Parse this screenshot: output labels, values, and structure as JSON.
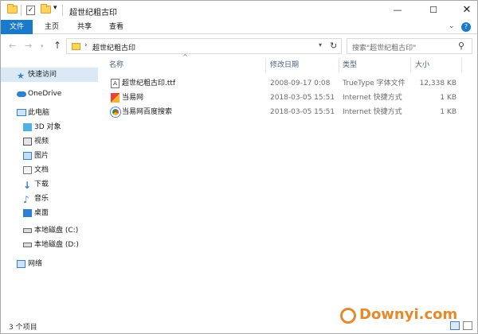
{
  "window": {
    "title": "超世纪粗古印",
    "controls": {
      "minimize": "—",
      "maximize": "☐",
      "close": "✕"
    }
  },
  "quick_access_toolbar": {
    "dropdown": "▾"
  },
  "ribbon": {
    "tabs": [
      "文件",
      "主页",
      "共享",
      "查看"
    ],
    "active_tab": "文件",
    "accent_color": "#1979ca",
    "expand_glyph": "⌄",
    "help_glyph": "?"
  },
  "navigation": {
    "back": "←",
    "forward": "→",
    "recent": "▾",
    "up": "↑",
    "path_separator": "›",
    "path": "超世纪粗古印",
    "dropdown": "▾",
    "refresh": "↻"
  },
  "search": {
    "placeholder": "搜索\"超世纪粗古印\"",
    "icon": "⚲"
  },
  "sidebar": {
    "items": [
      {
        "label": "快速访问",
        "icon": "star-icon"
      },
      {
        "label": "OneDrive",
        "icon": "cloud-icon"
      },
      {
        "label": "此电脑",
        "icon": "computer-icon"
      },
      {
        "label": "3D 对象",
        "icon": "cube-icon"
      },
      {
        "label": "视频",
        "icon": "video-icon"
      },
      {
        "label": "图片",
        "icon": "picture-icon"
      },
      {
        "label": "文档",
        "icon": "document-icon"
      },
      {
        "label": "下载",
        "icon": "download-icon"
      },
      {
        "label": "音乐",
        "icon": "music-icon"
      },
      {
        "label": "桌面",
        "icon": "desktop-icon"
      },
      {
        "label": "本地磁盘 (C:)",
        "icon": "drive-icon"
      },
      {
        "label": "本地磁盘 (D:)",
        "icon": "drive-icon"
      },
      {
        "label": "网络",
        "icon": "network-icon"
      }
    ]
  },
  "file_list": {
    "sort_glyph": "^",
    "columns": [
      "名称",
      "修改日期",
      "类型",
      "大小"
    ],
    "rows": [
      {
        "name": "超世纪粗古印.ttf",
        "date": "2008-09-17 0:08",
        "type": "TrueType 字体文件",
        "size": "12,338 KB",
        "icon": "font-file-icon"
      },
      {
        "name": "当易网",
        "date": "2018-03-05 15:51",
        "type": "Internet 快捷方式",
        "size": "1 KB",
        "icon": "internet-shortcut-icon"
      },
      {
        "name": "当易网百度搜索",
        "date": "2018-03-05 15:51",
        "type": "Internet 快捷方式",
        "size": "1 KB",
        "icon": "chrome-shortcut-icon"
      }
    ]
  },
  "status_bar": {
    "item_count": "3 个项目"
  },
  "watermark": {
    "text": "Downyi.com",
    "color": "#e48a2c"
  }
}
